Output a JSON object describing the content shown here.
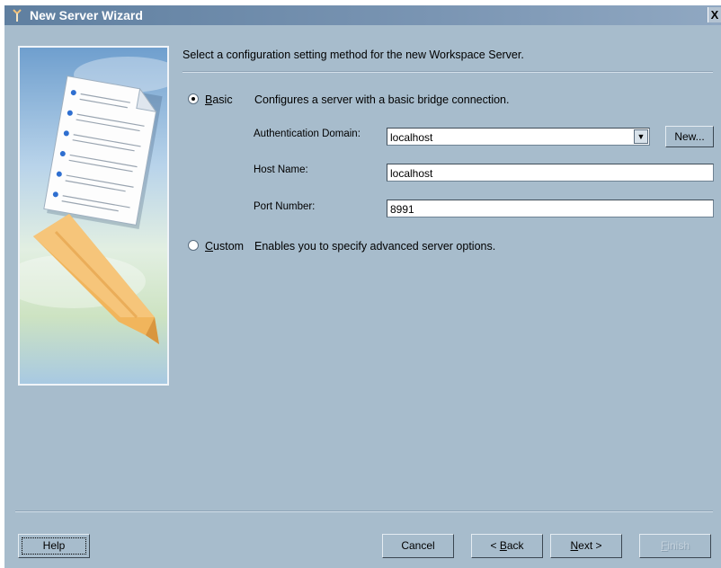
{
  "window": {
    "title": "New Server Wizard",
    "close_label": "X"
  },
  "intro_text": "Select a configuration setting method for the new Workspace Server.",
  "basic": {
    "label": "Basic",
    "label_mnemonic": "B",
    "label_rest": "asic",
    "description": "Configures a server with a basic bridge connection.",
    "selected": true
  },
  "custom": {
    "label": "Custom",
    "label_mnemonic": "C",
    "label_rest": "ustom",
    "description": "Enables you to specify advanced server options.",
    "selected": false
  },
  "fields": {
    "auth_domain_label": "Authentication Domain:",
    "auth_domain_value": "localhost",
    "new_button": "New...",
    "host_name_label": "Host Name:",
    "host_name_value": "localhost",
    "port_label": "Port Number:",
    "port_value": "8991"
  },
  "buttons": {
    "help": "Help",
    "cancel": "Cancel",
    "back_prefix": "< ",
    "back_mnemonic": "B",
    "back_rest": "ack",
    "next_mnemonic": "N",
    "next_rest": "ext >",
    "finish_mnemonic": "F",
    "finish_rest": "inish"
  },
  "icons": {
    "title": "sas-server-icon",
    "side": "document-and-ribbon-illustration"
  },
  "colors": {
    "window_bg": "#a7bccc",
    "titlebar": "#6e8aab",
    "text": "#000000"
  }
}
